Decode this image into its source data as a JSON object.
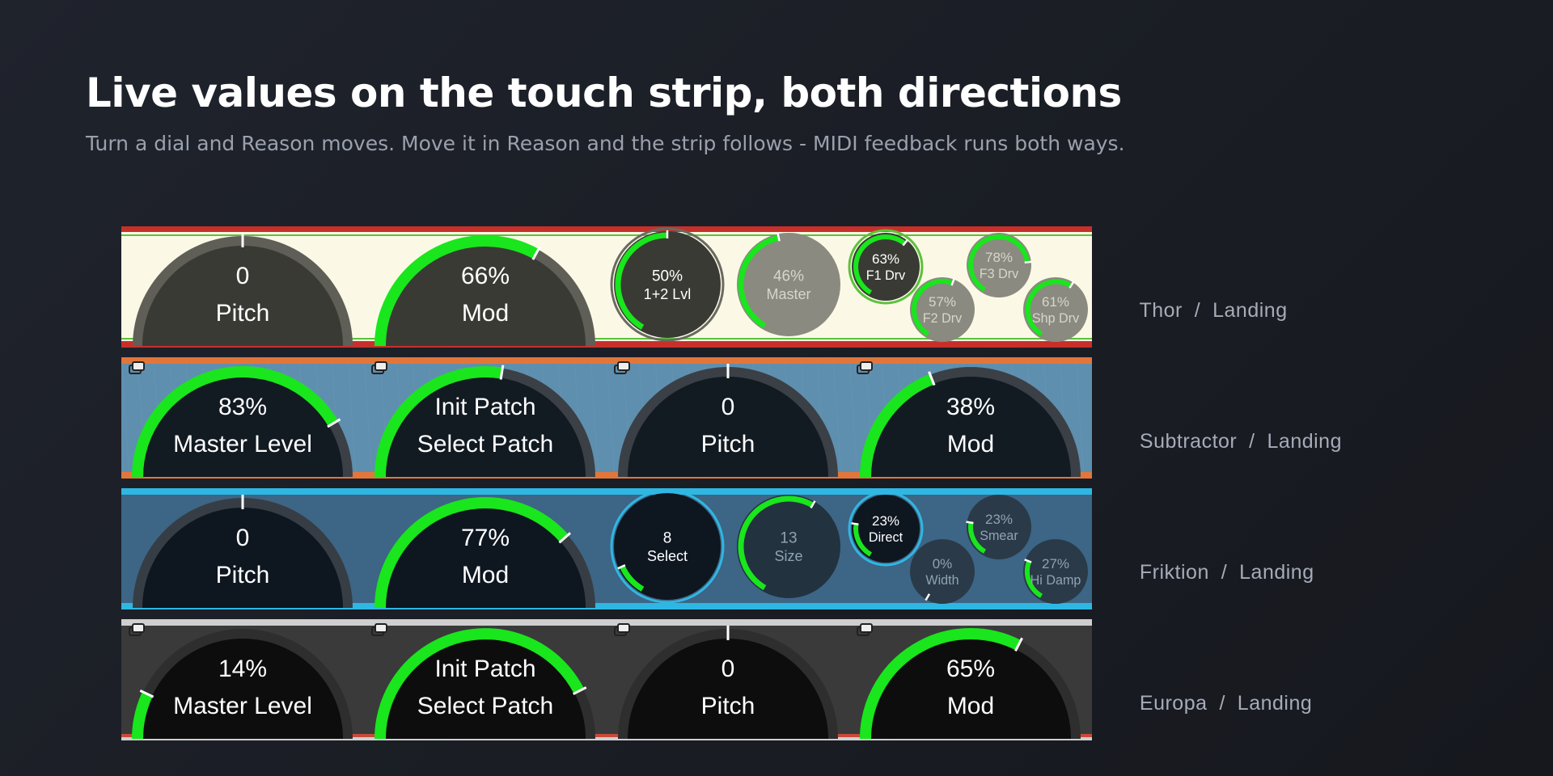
{
  "header": {
    "title": "Live values on the touch strip, both directions",
    "subtitle": "Turn a dial and Reason moves. Move it in Reason and the strip follows - MIDI feedback runs both ways."
  },
  "strips": [
    {
      "device": "Thor",
      "page": "Landing",
      "theme": {
        "bg": "#fbf9e6",
        "top": "#c7302a",
        "bottom": "#c7302a",
        "line": "#5bc23b",
        "dial": "#3a3a35",
        "ring": "#5f5f58",
        "grey": "#8a8a80"
      },
      "dials": [
        {
          "label": "Pitch",
          "value": "0",
          "level": 0.5,
          "kind": "big"
        },
        {
          "label": "Mod",
          "value": "66%",
          "level": 0.66,
          "kind": "big"
        },
        {
          "label": "1+2 Lvl",
          "value": "50%",
          "level": 0.5,
          "kind": "mid"
        },
        {
          "label": "Master",
          "value": "46%",
          "level": 0.46,
          "kind": "mid"
        },
        {
          "label": "F1 Drv",
          "value": "63%",
          "level": 0.63,
          "kind": "small"
        },
        {
          "label": "F3 Drv",
          "value": "78%",
          "level": 0.78,
          "kind": "small"
        },
        {
          "label": "F2 Drv",
          "value": "57%",
          "level": 0.57,
          "kind": "small"
        },
        {
          "label": "Shp Drv",
          "value": "61%",
          "level": 0.61,
          "kind": "small"
        }
      ]
    },
    {
      "device": "Subtractor",
      "page": "Landing",
      "theme": {
        "bg": "#5f8fae",
        "top": "#e2763a",
        "bottom": "#e2763a",
        "line": "#e2763a",
        "dial": "#121a22",
        "ring": "#3b4046",
        "grey": "#3b4046"
      },
      "dials": [
        {
          "label": "Master Level",
          "value": "83%",
          "level": 0.83,
          "kind": "big"
        },
        {
          "label": "Select Patch",
          "value": "Init Patch",
          "level": 0.55,
          "kind": "big"
        },
        {
          "label": "Pitch",
          "value": "0",
          "level": 0.5,
          "kind": "big"
        },
        {
          "label": "Mod",
          "value": "38%",
          "level": 0.38,
          "kind": "big"
        }
      ]
    },
    {
      "device": "Friktion",
      "page": "Landing",
      "theme": {
        "bg": "#3d6585",
        "top": "#2fb7e3",
        "bottom": "#2fb7e3",
        "line": "#2fb7e3",
        "dial": "#0e1620",
        "ring": "#363d45",
        "grey": "#2a3a48"
      },
      "dials": [
        {
          "label": "Pitch",
          "value": "0",
          "level": 0.5,
          "kind": "big"
        },
        {
          "label": "Mod",
          "value": "77%",
          "level": 0.77,
          "kind": "big"
        },
        {
          "label": "Select",
          "value": "8",
          "level": 0.12,
          "kind": "mid"
        },
        {
          "label": "Size",
          "value": "13",
          "level": 0.6,
          "kind": "mid"
        },
        {
          "label": "Direct",
          "value": "23%",
          "level": 0.23,
          "kind": "small"
        },
        {
          "label": "Smear",
          "value": "23%",
          "level": 0.23,
          "kind": "small"
        },
        {
          "label": "Width",
          "value": "0%",
          "level": 0.0,
          "kind": "small"
        },
        {
          "label": "Hi Damp",
          "value": "27%",
          "level": 0.27,
          "kind": "small"
        }
      ]
    },
    {
      "device": "Europa",
      "page": "Landing",
      "theme": {
        "bg": "#3a3a3a",
        "top": "#cfcfcf",
        "bottom": "#c94a3a",
        "line": "#c94a3a",
        "dial": "#0d0d0d",
        "ring": "#2e2e2e",
        "grey": "#2e2e2e"
      },
      "dials": [
        {
          "label": "Master Level",
          "value": "14%",
          "level": 0.14,
          "kind": "big"
        },
        {
          "label": "Select Patch",
          "value": "Init Patch",
          "level": 0.85,
          "kind": "big"
        },
        {
          "label": "Pitch",
          "value": "0",
          "level": 0.5,
          "kind": "big"
        },
        {
          "label": "Mod",
          "value": "65%",
          "level": 0.65,
          "kind": "big"
        }
      ]
    }
  ],
  "separator": "/",
  "colors": {
    "accent": "#19e61c",
    "indicator": "#ffffff"
  }
}
